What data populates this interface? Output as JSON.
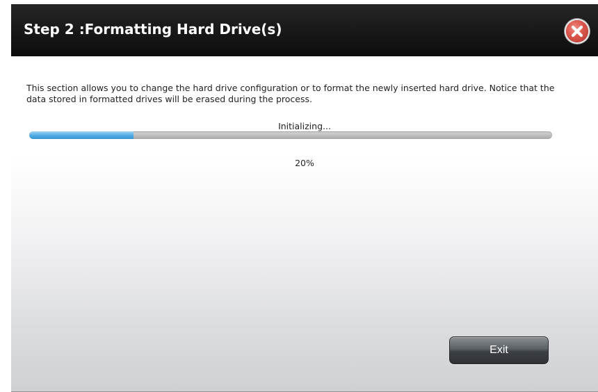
{
  "dialog": {
    "title": "Step 2 :Formatting Hard Drive(s)",
    "close_icon": "close-icon",
    "description": "This section allows you to change the hard drive configuration or to format the newly inserted hard drive. Notice that the data stored in formatted drives will be erased during the process.",
    "status": "Initializing...",
    "progress": {
      "percent_value": 20,
      "percent_label": "20%"
    },
    "exit_label": "Exit"
  },
  "colors": {
    "titlebar": "#111111",
    "progress_fill": "#4aa8e0",
    "progress_track": "#b8b8b8",
    "close_button": "#d9534a",
    "exit_button": "#4a4f53"
  }
}
